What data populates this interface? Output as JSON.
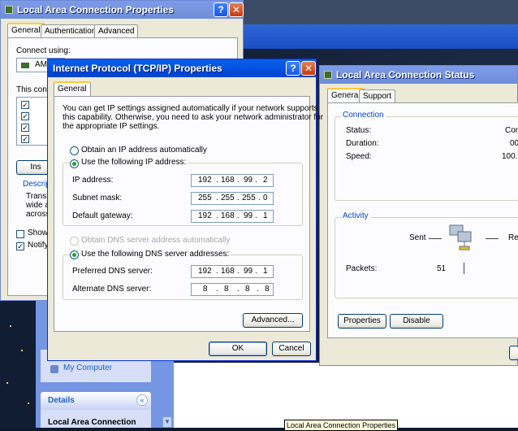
{
  "lac_props": {
    "title": "Local Area Connection Properties",
    "tabs": [
      "General",
      "Authentication",
      "Advanced"
    ],
    "connect_using": "Connect using:",
    "adapter_short": "AM",
    "this_conn": "This conn",
    "ins": "Ins",
    "descr": "Descrip",
    "desc_lines": [
      "Transm",
      "wide ar",
      "across"
    ],
    "show": "Show",
    "notify": "Notify"
  },
  "tcpip": {
    "title": "Internet Protocol (TCP/IP) Properties",
    "tab": "General",
    "intro": [
      "You can get IP settings assigned automatically if your network supports",
      "this capability. Otherwise, you need to ask your network administrator for",
      "the appropriate IP settings."
    ],
    "obtain_ip": "Obtain an IP address automatically",
    "use_ip": "Use the following IP address:",
    "ip_label": "IP address:",
    "ip": [
      "192",
      "168",
      "99",
      "2"
    ],
    "mask_label": "Subnet mask:",
    "mask": [
      "255",
      "255",
      "255",
      "0"
    ],
    "gw_label": "Default gateway:",
    "gw": [
      "192",
      "168",
      "99",
      "1"
    ],
    "obtain_dns": "Obtain DNS server address automatically",
    "use_dns": "Use the following DNS server addresses:",
    "pref_label": "Preferred DNS server:",
    "pref": [
      "192",
      "168",
      "99",
      "1"
    ],
    "alt_label": "Alternate DNS server:",
    "alt": [
      "8",
      "8",
      "8",
      "8"
    ],
    "advanced": "Advanced...",
    "ok": "OK",
    "cancel": "Cancel",
    "help": "?",
    "close": "X"
  },
  "status": {
    "title": "Local Area Connection Status",
    "tabs": [
      "General",
      "Support"
    ],
    "connection": "Connection",
    "status_label": "Status:",
    "status_val": "Con",
    "duration_label": "Duration:",
    "duration_val": "00",
    "speed_label": "Speed:",
    "speed_val": "100.0",
    "activity": "Activity",
    "sent": "Sent",
    "received": "Re",
    "packets_label": "Packets:",
    "packets_sent": "51",
    "properties": "Properties",
    "disable": "Disable"
  },
  "explorer": {
    "my_computer": "My Computer",
    "details": "Details",
    "details_item": "Local Area Connection",
    "collapse": "«"
  },
  "tooltip": "Local Area Connection Properties"
}
